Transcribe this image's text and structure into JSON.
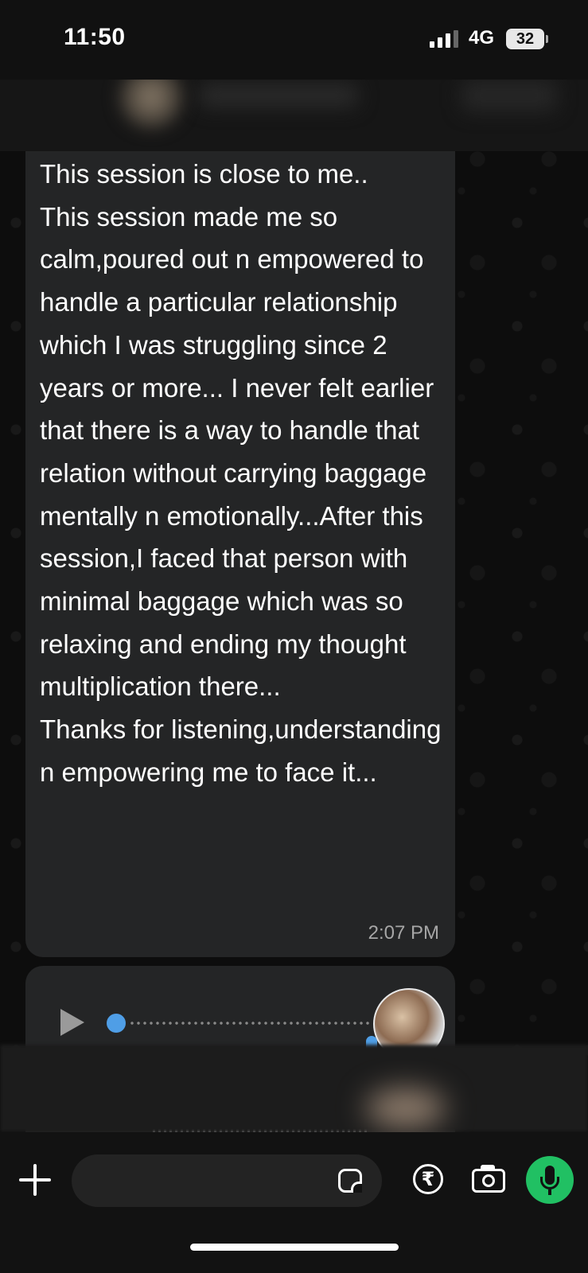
{
  "status_bar": {
    "time": "11:50",
    "network": "4G",
    "battery": "32"
  },
  "chat": {
    "message": {
      "text": "This session is close to me..\nThis session made me so calm,poured out n empowered to handle a particular relationship which I was struggling since 2 years or more... I never felt earlier that there is a way to handle that relation without carrying baggage mentally n emotionally...After this session,I faced that person with minimal baggage which was so relaxing and ending my thought multiplication there...\nThanks for listening,understanding n empowering me to face it...",
      "time": "2:07 PM"
    },
    "voice_message": {
      "accent_color": "#4f9ee6"
    }
  },
  "input_bar": {
    "message_placeholder": "",
    "rupee_symbol": "₹",
    "mic_color": "#21c063"
  },
  "icons": [
    "signal-icon",
    "battery-icon",
    "play-icon",
    "plus-icon",
    "sticker-icon",
    "rupee-icon",
    "camera-icon",
    "mic-icon"
  ]
}
